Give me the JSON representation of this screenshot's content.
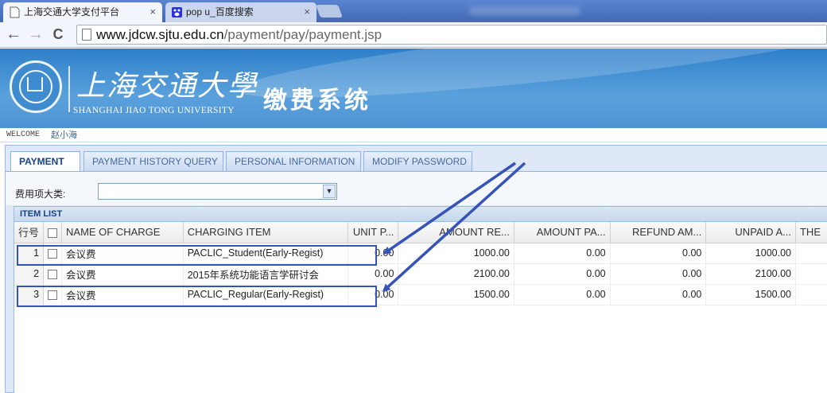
{
  "browser": {
    "tabs": [
      {
        "title": "上海交通大学支付平台",
        "close": "×"
      },
      {
        "title": "pop u_百度搜索",
        "close": "×"
      }
    ],
    "url_host": "www.jdcw.sjtu.edu.cn",
    "url_path": "/payment/pay/payment.jsp",
    "back": "←",
    "forward": "→",
    "reload": "C"
  },
  "header": {
    "university_cn": "上海交通大學",
    "university_en": "SHANGHAI JIAO TONG UNIVERSITY",
    "system_title": "缴费系统",
    "welcome_label": "WELCOME",
    "user_name": "赵小海"
  },
  "nav_tabs": [
    "PAYMENT",
    "PAYMENT HISTORY QUERY",
    "PERSONAL INFORMATION",
    "MODIFY PASSWORD"
  ],
  "filter": {
    "label": "费用项大类:",
    "selected": "",
    "arrow": "▼"
  },
  "grid": {
    "title": "ITEM LIST",
    "columns": [
      "行号",
      "",
      "NAME OF CHARGE",
      "CHARGING ITEM",
      "UNIT P...",
      "AMOUNT RE...",
      "AMOUNT PA...",
      "REFUND AM...",
      "UNPAID A...",
      "THE"
    ],
    "rows": [
      {
        "no": "1",
        "name": "会议费",
        "item": "PACLIC_Student(Early-Regist)",
        "unit_price": "0.00",
        "amount_receivable": "1000.00",
        "amount_paid": "0.00",
        "refund": "0.00",
        "unpaid": "1000.00",
        "the": ""
      },
      {
        "no": "2",
        "name": "会议费",
        "item": "2015年系统功能语言学研讨会",
        "unit_price": "0.00",
        "amount_receivable": "2100.00",
        "amount_paid": "0.00",
        "refund": "0.00",
        "unpaid": "2100.00",
        "the": ""
      },
      {
        "no": "3",
        "name": "会议费",
        "item": "PACLIC_Regular(Early-Regist)",
        "unit_price": "0.00",
        "amount_receivable": "1500.00",
        "amount_paid": "0.00",
        "refund": "0.00",
        "unpaid": "1500.00",
        "the": ""
      }
    ]
  },
  "colors": {
    "annotation": "#3553b8",
    "header_blue": "#3a88cf",
    "panel": "#dfe8f6"
  }
}
